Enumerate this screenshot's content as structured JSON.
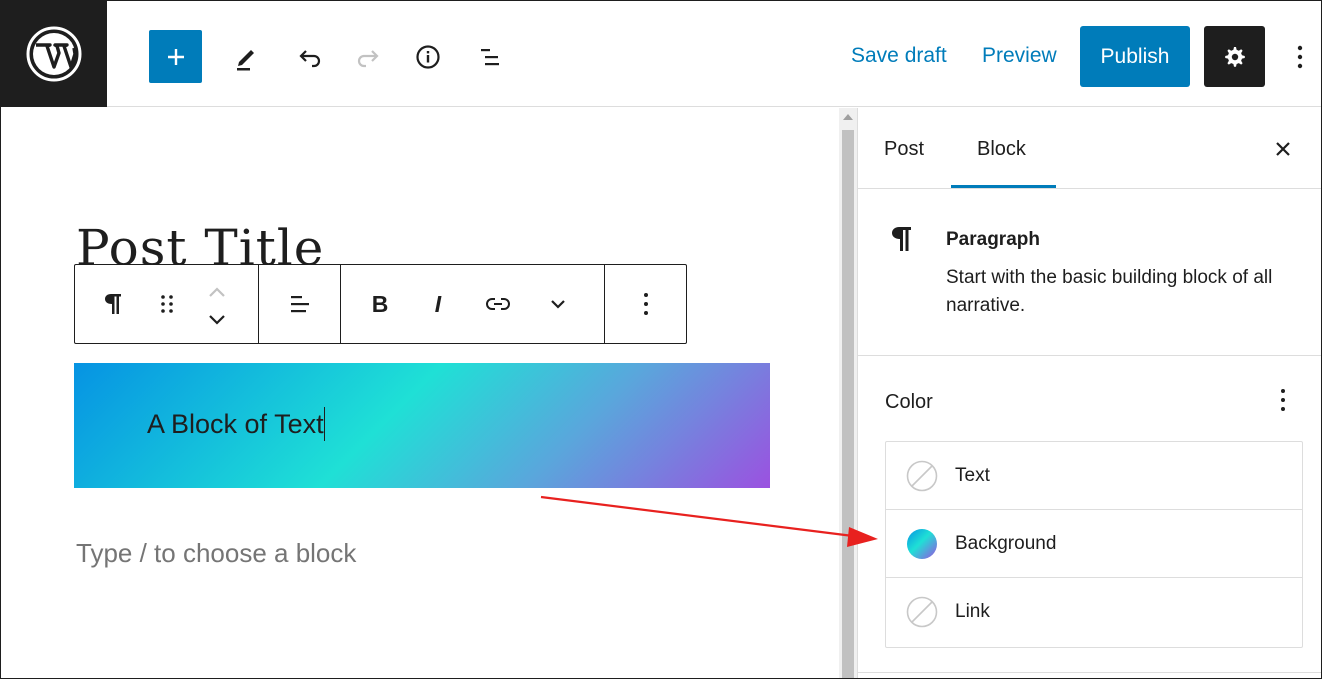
{
  "topbar": {
    "logo_icon": "wordpress-logo-icon",
    "add_icon": "plus-icon",
    "tools": [
      "pencil-icon",
      "undo-icon",
      "redo-icon",
      "info-icon",
      "list-view-icon"
    ],
    "save_draft_label": "Save draft",
    "preview_label": "Preview",
    "publish_label": "Publish",
    "settings_icon": "gear-icon",
    "options_icon": "more-vertical-icon"
  },
  "editor": {
    "post_title": "Post Title",
    "block_toolbar": {
      "items": [
        "paragraph-icon",
        "drag-handle-icon",
        "move-up-icon",
        "move-down-icon",
        "align-icon",
        "bold-icon",
        "italic-icon",
        "link-icon",
        "chevron-down-icon",
        "more-vertical-icon"
      ],
      "bold_label": "B",
      "italic_label": "I"
    },
    "text_block": "A Block of Text",
    "placeholder": "Type / to choose a block"
  },
  "sidebar": {
    "tabs": [
      {
        "label": "Post",
        "active": false
      },
      {
        "label": "Block",
        "active": true
      }
    ],
    "close_icon": "close-icon",
    "block_card": {
      "icon": "paragraph-icon",
      "title": "Paragraph",
      "description": "Start with the basic building block of all narrative."
    },
    "color_panel": {
      "title": "Color",
      "items": [
        {
          "label": "Text",
          "swatch": "none"
        },
        {
          "label": "Background",
          "swatch": "gradient"
        },
        {
          "label": "Link",
          "swatch": "none"
        }
      ]
    }
  },
  "colors": {
    "accent": "#007cba",
    "dark": "#1e1e1e",
    "gradient_start": "#0693e3",
    "gradient_mid": "#1fe0d6",
    "gradient_end": "#9b51e0",
    "annotation_arrow": "#e8211f"
  }
}
